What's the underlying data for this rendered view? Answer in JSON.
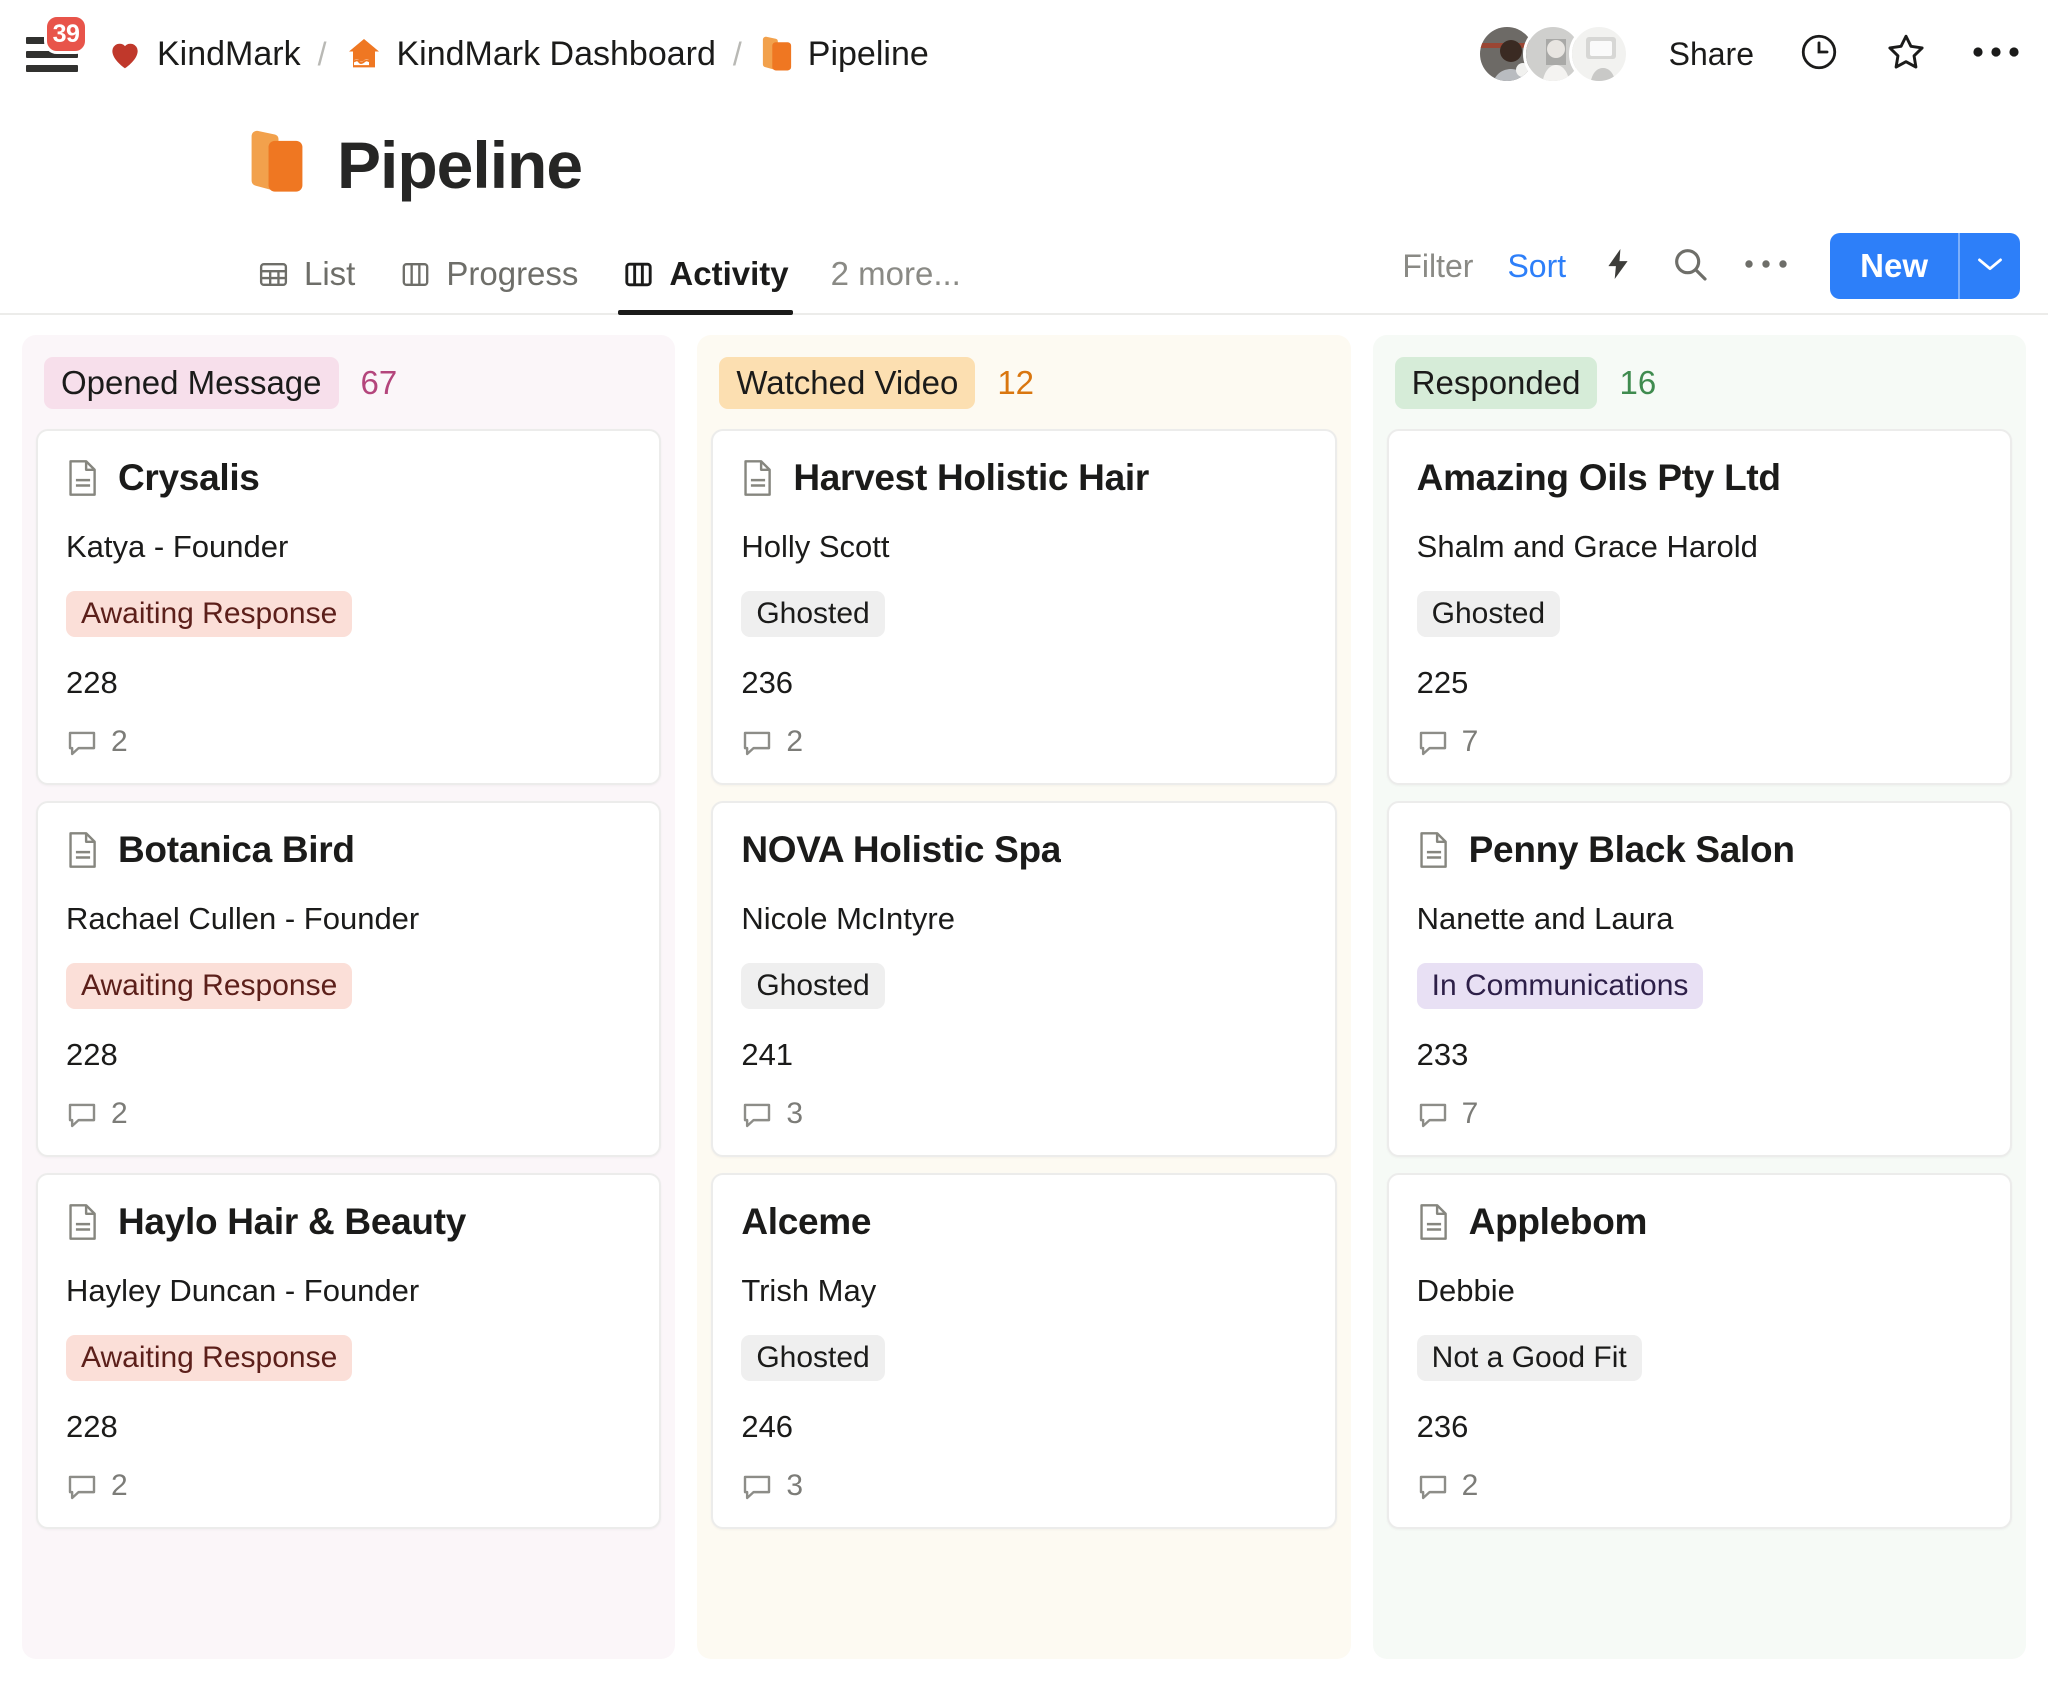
{
  "topbar": {
    "notification_count": "39",
    "breadcrumbs": [
      {
        "icon": "heart-icon",
        "label": "KindMark"
      },
      {
        "icon": "house-icon",
        "label": "KindMark Dashboard"
      },
      {
        "icon": "folder-icon",
        "label": "Pipeline"
      }
    ],
    "separator": "/",
    "share_label": "Share",
    "icons": [
      "history-clock-icon",
      "star-icon",
      "more-horizontal-icon"
    ]
  },
  "page": {
    "title": "Pipeline",
    "icon": "folder-icon"
  },
  "tabs": [
    {
      "label": "List",
      "icon": "grid-table-icon",
      "active": false
    },
    {
      "label": "Progress",
      "icon": "columns-icon",
      "active": false
    },
    {
      "label": "Activity",
      "icon": "columns-icon",
      "active": true
    }
  ],
  "tabs_overflow_label": "2 more...",
  "toolbar": {
    "filter_label": "Filter",
    "sort_label": "Sort",
    "automation_icon": "lightning-bolt-icon",
    "search_icon": "search-icon",
    "more_icon": "more-horizontal-icon",
    "new_label": "New",
    "new_caret_icon": "chevron-down-icon"
  },
  "colors": {
    "accent_blue": "#2d7ff9",
    "notification_red": "#e8544a",
    "brand_orange": "#f0681f",
    "col1_bg": "#fbf6f9",
    "col1_chip_bg": "#f7dfeb",
    "col1_count": "#b4457c",
    "col2_bg": "#fdfaf2",
    "col2_chip_bg": "#fcdfb1",
    "col2_count": "#d9760f",
    "col3_bg": "#f6faf6",
    "col3_chip_bg": "#d6ecd8",
    "col3_count": "#3f8b4f",
    "badge_pink_bg": "#fbdfd8",
    "badge_pink_text": "#5c1f1a",
    "badge_gray_bg": "#efefef",
    "badge_gray_text": "#1b1b1a",
    "badge_purple_bg": "#e8e0f4",
    "badge_purple_text": "#2d1f48"
  },
  "columns": [
    {
      "name": "Opened Message",
      "count": "67",
      "cards": [
        {
          "title": "Crysalis",
          "has_doc_icon": true,
          "person": "Katya - Founder",
          "badge": "Awaiting Response",
          "badge_style": "pink",
          "number": "228",
          "comments": "2"
        },
        {
          "title": "Botanica Bird",
          "has_doc_icon": true,
          "person": "Rachael Cullen - Founder",
          "badge": "Awaiting Response",
          "badge_style": "pink",
          "number": "228",
          "comments": "2"
        },
        {
          "title": "Haylo Hair & Beauty",
          "has_doc_icon": true,
          "person": "Hayley Duncan - Founder",
          "badge": "Awaiting Response",
          "badge_style": "pink",
          "number": "228",
          "comments": "2"
        }
      ]
    },
    {
      "name": "Watched Video",
      "count": "12",
      "cards": [
        {
          "title": "Harvest Holistic Hair",
          "has_doc_icon": true,
          "person": "Holly Scott",
          "badge": "Ghosted",
          "badge_style": "gray",
          "number": "236",
          "comments": "2"
        },
        {
          "title": "NOVA Holistic Spa",
          "has_doc_icon": false,
          "person": "Nicole McIntyre",
          "badge": "Ghosted",
          "badge_style": "gray",
          "number": "241",
          "comments": "3"
        },
        {
          "title": "Alceme",
          "has_doc_icon": false,
          "person": "Trish May",
          "badge": "Ghosted",
          "badge_style": "gray",
          "number": "246",
          "comments": "3"
        }
      ]
    },
    {
      "name": "Responded",
      "count": "16",
      "cards": [
        {
          "title": "Amazing Oils Pty Ltd",
          "has_doc_icon": false,
          "person": "Shalm and Grace Harold",
          "badge": "Ghosted",
          "badge_style": "gray",
          "number": "225",
          "comments": "7"
        },
        {
          "title": "Penny Black Salon",
          "has_doc_icon": true,
          "person": "Nanette and Laura",
          "badge": "In Communications",
          "badge_style": "purple",
          "number": "233",
          "comments": "7"
        },
        {
          "title": "Applebom",
          "has_doc_icon": true,
          "person": "Debbie",
          "badge": "Not a Good Fit",
          "badge_style": "gray",
          "number": "236",
          "comments": "2"
        }
      ]
    }
  ]
}
